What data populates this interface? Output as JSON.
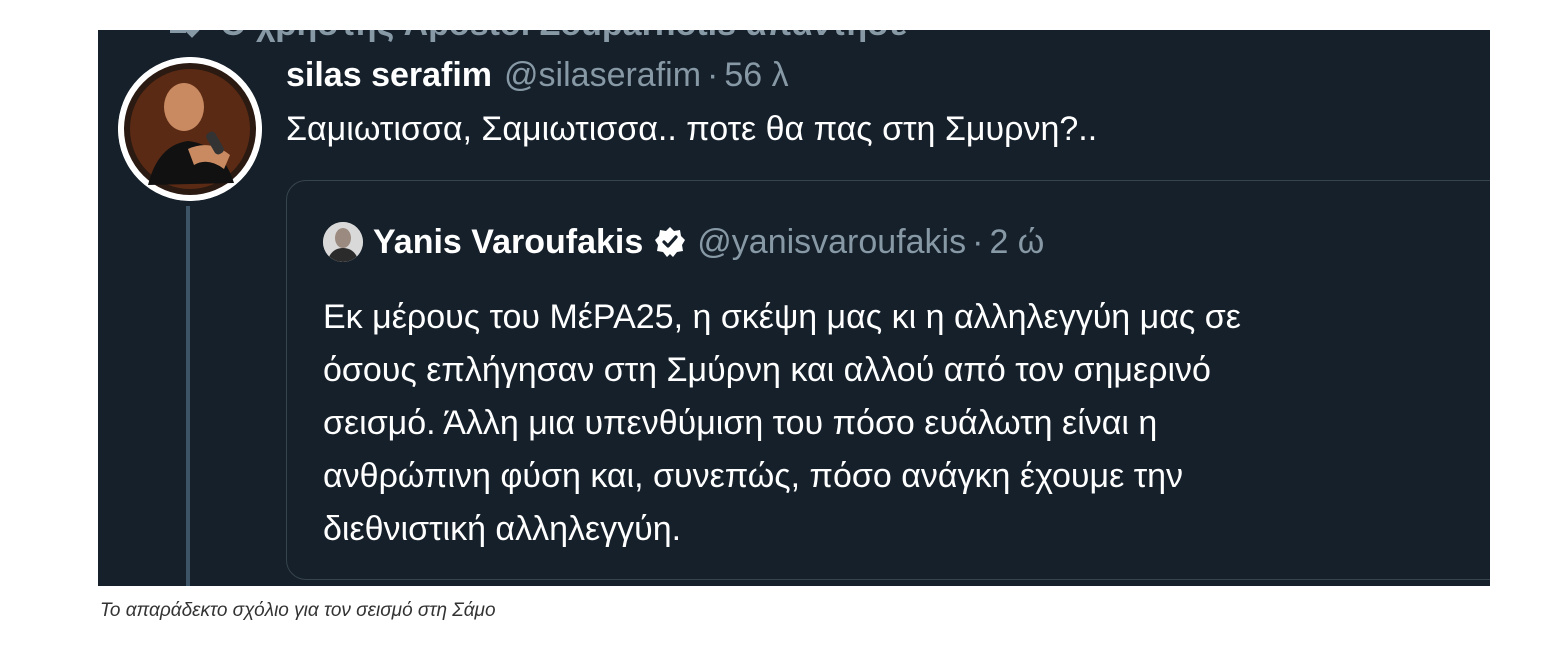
{
  "context": {
    "text": "Ο χρήστης Apostol Zouparnotis απαντησε"
  },
  "tweet": {
    "display_name": "silas serafim",
    "handle": "@silaserafim",
    "separator": "·",
    "timestamp": "56 λ",
    "text": "Σαμιωτισσα, Σαμιωτισσα.. ποτε θα πας στη Σμυρνη?.."
  },
  "quote": {
    "display_name": "Yanis Varoufakis",
    "handle": "@yanisvaroufakis",
    "separator": "·",
    "timestamp": "2 ώ",
    "verified_icon": "verified-badge-icon",
    "lines": [
      "Εκ μέρους του ΜέΡΑ25, η σκέψη μας κι η αλληλεγγύη μας σε",
      "όσους επλήγησαν στη Σμύρνη και αλλού από τον σημερινό",
      "σεισμό. Άλλη μια υπενθύμιση του πόσο ευάλωτη είναι η",
      "ανθρώπινη φύση και, συνεπώς, πόσο ανάγκη έχουμε την",
      "διεθνιστική αλληλεγγύη."
    ]
  },
  "caption": "Το απαράδεκτο σχόλιο για τον σεισμό στη Σάμο",
  "colors": {
    "background": "#15202b",
    "secondary_text": "#8899a6",
    "primary_text": "#ffffff",
    "border": "#38444d"
  }
}
